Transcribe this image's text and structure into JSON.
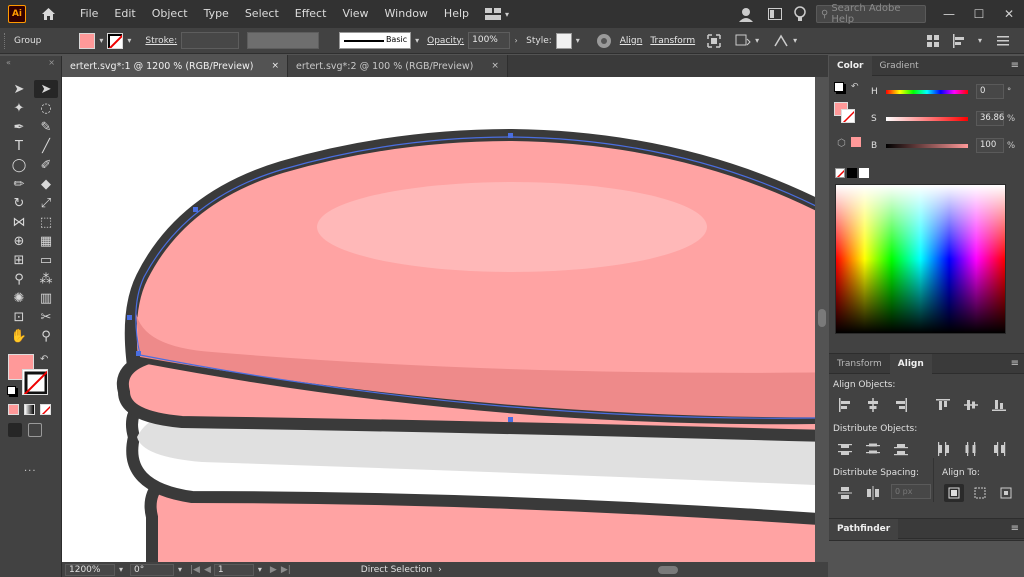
{
  "app": {
    "logo_text": "Ai"
  },
  "menu": [
    "File",
    "Edit",
    "Object",
    "Type",
    "Select",
    "Effect",
    "View",
    "Window",
    "Help"
  ],
  "search": {
    "placeholder": "Search Adobe Help"
  },
  "control_bar": {
    "selection_label": "Group",
    "stroke_label": "Stroke:",
    "brush_label": "Basic",
    "opacity_label": "Opacity:",
    "opacity_value": "100%",
    "style_label": "Style:",
    "align_button": "Align",
    "transform_button": "Transform"
  },
  "tabs": [
    {
      "label": "ertert.svg*:1 @ 1200 % (RGB/Preview)",
      "close": "×",
      "active": true
    },
    {
      "label": "ertert.svg*:2 @ 100 % (RGB/Preview)",
      "close": "×",
      "active": false
    }
  ],
  "status_bar": {
    "zoom": "1200%",
    "rotation": "0°",
    "artboard": "1",
    "tool": "Direct Selection"
  },
  "color_panel": {
    "tabs": [
      "Color",
      "Gradient"
    ],
    "h_label": "H",
    "h_value": "0",
    "s_label": "S",
    "s_value": "36.86",
    "b_label": "B",
    "b_value": "100",
    "pct": "%"
  },
  "align_panel": {
    "tabs": [
      "Transform",
      "Align"
    ],
    "align_objects": "Align Objects:",
    "distribute_objects": "Distribute Objects:",
    "distribute_spacing": "Distribute Spacing:",
    "align_to": "Align To:",
    "spacing_value": "0 px"
  },
  "pathfinder_panel": {
    "title": "Pathfinder"
  },
  "colors": {
    "fill": "#ff9999",
    "macaron_top": "#ffa3a3",
    "macaron_shadow": "#ee8a8a",
    "macaron_highlight": "#ffb8b8",
    "outline": "#3a3a3a",
    "selection": "#4a6ee0"
  }
}
